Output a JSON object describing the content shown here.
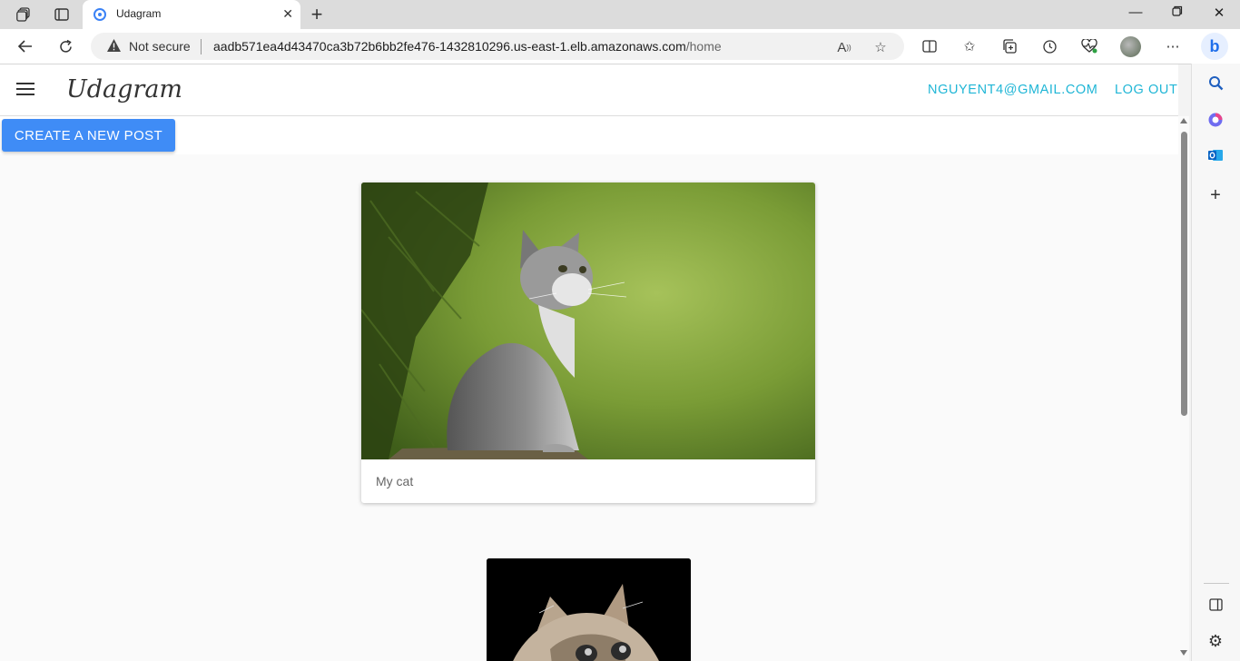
{
  "browser": {
    "tab_title": "Udagram",
    "security_label": "Not secure",
    "url_host": "aadb571ea4d43470ca3b72b6bb2fe476-1432810296.us-east-1.elb.amazonaws.com",
    "url_path": "/home",
    "icons": {
      "workspaces": "workspaces-icon",
      "tab_actions": "tab-actions-icon",
      "back": "back-arrow-icon",
      "refresh": "refresh-icon",
      "warning": "warning-icon",
      "read_aloud": "read-aloud-icon",
      "favorite": "star-icon",
      "split_screen": "split-screen-icon",
      "favorites": "favorites-icon",
      "collections": "collections-icon",
      "history": "history-icon",
      "performance": "heartbeat-icon",
      "profile": "avatar",
      "more": "more-icon",
      "copilot": "bing-copilot-icon"
    }
  },
  "sidebar": {
    "icons": [
      "search-icon",
      "copilot-icon",
      "outlook-icon",
      "add-icon",
      "sidebar-panel-icon",
      "settings-icon"
    ]
  },
  "app": {
    "brand": "Udagram",
    "user_email": "NGUYENT4@GMAIL.COM",
    "logout_label": "LOG OUT",
    "create_post_label": "CREATE A NEW POST",
    "posts": [
      {
        "caption": "My cat"
      },
      {
        "caption": ""
      }
    ]
  },
  "colors": {
    "accent": "#20b6d6",
    "primary_button": "#3f8cf6"
  }
}
